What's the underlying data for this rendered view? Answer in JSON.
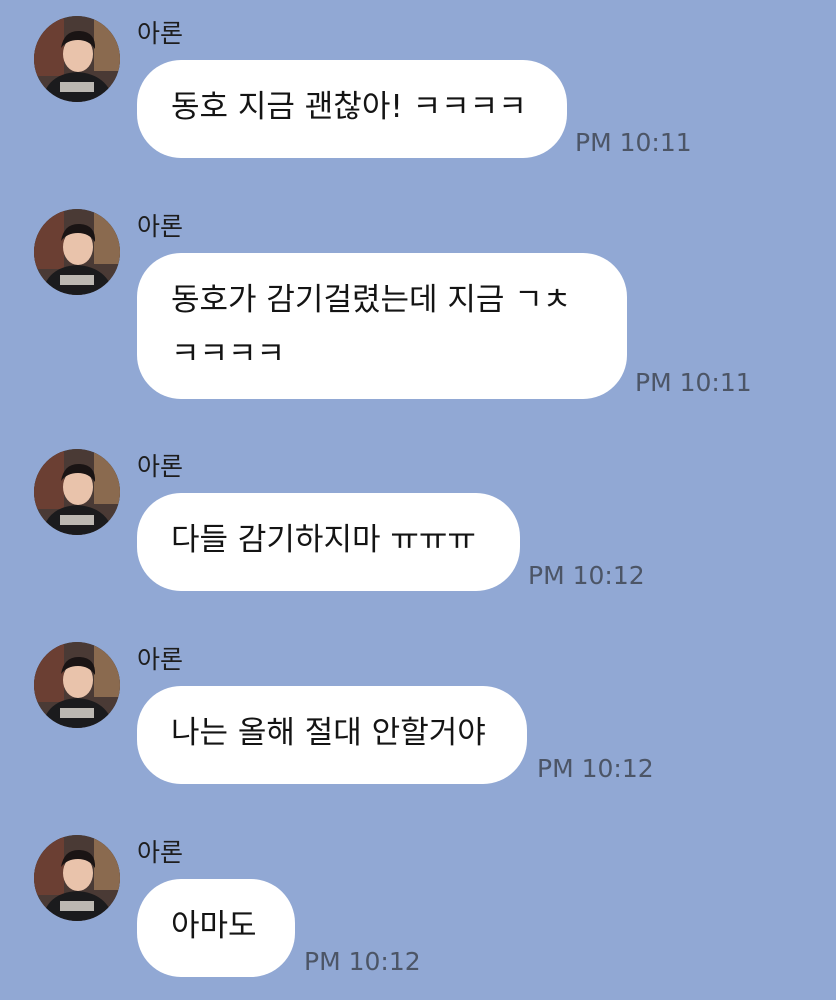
{
  "chat": {
    "messages": [
      {
        "sender": "아론",
        "text": "동호 지금 괜찮아! ㅋㅋㅋㅋ",
        "time": "PM 10:11"
      },
      {
        "sender": "아론",
        "text": "동호가 감기걸렸는데 지금 ㄱㅊ\nㅋㅋㅋㅋ",
        "time": "PM 10:11"
      },
      {
        "sender": "아론",
        "text": "다들 감기하지마 ㅠㅠㅠ",
        "time": "PM 10:12"
      },
      {
        "sender": "아론",
        "text": "나는 올해 절대 안할거야",
        "time": "PM 10:12"
      },
      {
        "sender": "아론",
        "text": "아마도",
        "time": "PM 10:12"
      }
    ]
  },
  "colors": {
    "background": "#91a8d4",
    "bubble": "#ffffff",
    "timestamp": "#4c5566"
  },
  "icons": {
    "avatar": "profile-photo-avatar"
  }
}
